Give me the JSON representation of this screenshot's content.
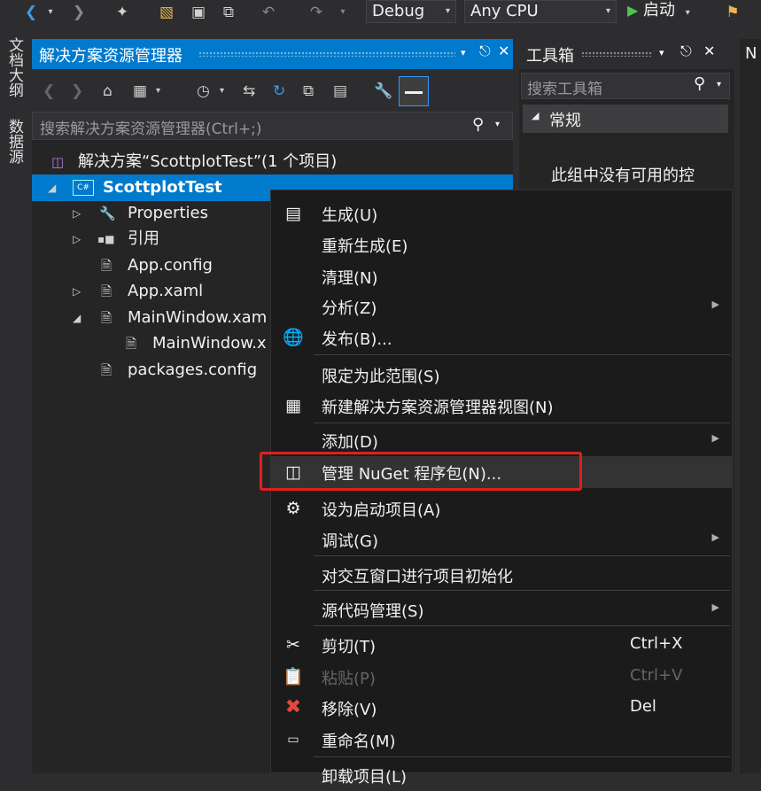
{
  "toolbar": {
    "config": "Debug",
    "platform": "Any CPU",
    "start_label": "启动"
  },
  "left_tabs": [
    "文档大纲",
    "数据源"
  ],
  "solution_explorer": {
    "title": "解决方案资源管理器",
    "search_placeholder": "搜索解决方案资源管理器(Ctrl+;)",
    "tree": [
      {
        "label": "解决方案“ScottplotTest”(1 个项目)",
        "icon": "solution-icon"
      },
      {
        "label": "ScottplotTest",
        "icon": "csharp-project-icon",
        "selected": true
      },
      {
        "label": "Properties",
        "icon": "wrench-icon"
      },
      {
        "label": "引用",
        "icon": "references-icon"
      },
      {
        "label": "App.config",
        "icon": "config-file-icon"
      },
      {
        "label": "App.xaml",
        "icon": "xaml-file-icon"
      },
      {
        "label": "MainWindow.xam",
        "icon": "xaml-file-icon"
      },
      {
        "label": "MainWindow.x",
        "icon": "code-file-icon"
      },
      {
        "label": "packages.config",
        "icon": "config-file-icon"
      }
    ]
  },
  "toolbox": {
    "title": "工具箱",
    "search_placeholder": "搜索工具箱",
    "group": "常规",
    "empty_message": "此组中没有可用的控"
  },
  "right_tab": "N",
  "context_menu": {
    "items": [
      {
        "label": "生成(U)",
        "icon": "build-icon"
      },
      {
        "label": "重新生成(E)"
      },
      {
        "label": "清理(N)"
      },
      {
        "label": "分析(Z)"
      },
      {
        "label": "发布(B)...",
        "icon": "globe-icon"
      },
      {
        "label": "限定为此范围(S)"
      },
      {
        "label": "新建解决方案资源管理器视图(N)",
        "icon": "new-view-icon"
      },
      {
        "label": "添加(D)"
      },
      {
        "label": "管理 NuGet 程序包(N)...",
        "icon": "nuget-icon",
        "highlighted": true
      },
      {
        "label": "设为启动项目(A)",
        "icon": "gear-icon"
      },
      {
        "label": "调试(G)"
      },
      {
        "label": "对交互窗口进行项目初始化"
      },
      {
        "label": "源代码管理(S)"
      },
      {
        "label": "剪切(T)",
        "shortcut": "Ctrl+X",
        "icon": "scissors-icon"
      },
      {
        "label": "粘贴(P)",
        "shortcut": "Ctrl+V",
        "icon": "paste-icon",
        "disabled": true
      },
      {
        "label": "移除(V)",
        "shortcut": "Del",
        "icon": "remove-icon"
      },
      {
        "label": "重命名(M)",
        "icon": "rename-icon"
      },
      {
        "label": "卸载项目(L)"
      }
    ]
  },
  "colors": {
    "accent": "#007acc",
    "highlight_box": "#e0201b",
    "remove_icon": "#e4483d",
    "globe_icon": "#3a8fdc"
  }
}
